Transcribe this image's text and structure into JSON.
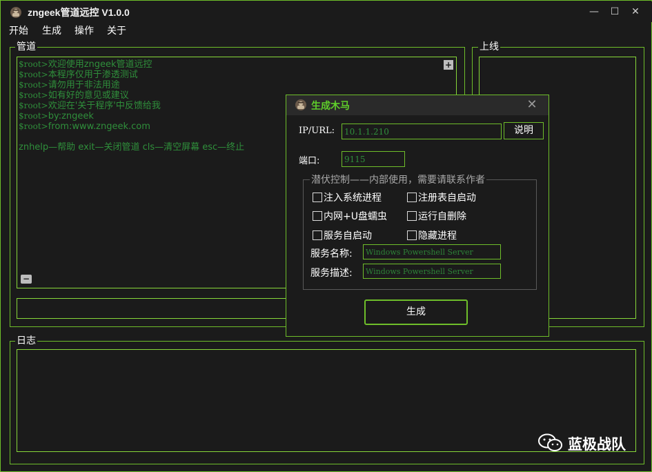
{
  "window": {
    "title": "zngeek管道远控 V1.0.0",
    "controls": {
      "minimize": "—",
      "maximize": "☐",
      "close": "✕"
    }
  },
  "menu": [
    "开始",
    "生成",
    "操作",
    "关于"
  ],
  "pipe_panel": {
    "label": "管道",
    "terminal_lines": [
      {
        "prefix": "$root>",
        "text": "欢迎使用zngeek管道远控"
      },
      {
        "prefix": "$root>",
        "text": "本程序仅用于渗透测试"
      },
      {
        "prefix": "$root>",
        "text": "请勿用于非法用途"
      },
      {
        "prefix": "$root>",
        "text": "如有好的意见或建议"
      },
      {
        "prefix": "$root>",
        "text": "欢迎在'关于程序'中反馈给我"
      },
      {
        "prefix": "$root>",
        "text": "by:zngeek"
      },
      {
        "prefix": "$root>",
        "text": "from:www.zngeek.com"
      },
      {
        "prefix": "",
        "text": ""
      },
      {
        "prefix": "",
        "text": "znhelp—帮助 exit—关闭管道 cls—清空屏幕 esc—终止"
      }
    ],
    "expand_glyph": "+",
    "collapse_glyph": "−"
  },
  "online_panel": {
    "label": "上线"
  },
  "log_panel": {
    "label": "日志"
  },
  "dialog": {
    "title": "生成木马",
    "close_glyph": "✕",
    "ip_label": "IP/URL:",
    "ip_value": "10.1.1.210",
    "explain_button": "说明",
    "port_label": "端口:",
    "port_value": "9115",
    "section_label": "潜伏控制——内部使用，需要请联系作者",
    "options": [
      {
        "label": "注入系统进程",
        "checked": false
      },
      {
        "label": "注册表自启动",
        "checked": false
      },
      {
        "label": "内网+U盘蠕虫",
        "checked": false
      },
      {
        "label": "运行自删除",
        "checked": false
      },
      {
        "label": "服务自启动",
        "checked": false
      },
      {
        "label": "隐藏进程",
        "checked": false
      }
    ],
    "service_name_label": "服务名称:",
    "service_name_placeholder": "Windows Powershell Server",
    "service_desc_label": "服务描述:",
    "service_desc_placeholder": "Windows Powershell Server",
    "generate_button": "生成"
  },
  "watermark": {
    "text": "蓝极战队",
    "icon": "wechat-icon"
  },
  "colors": {
    "accent": "#6fbf2a",
    "terminal_green": "#2f8f3b",
    "background": "#1b1b1b"
  }
}
